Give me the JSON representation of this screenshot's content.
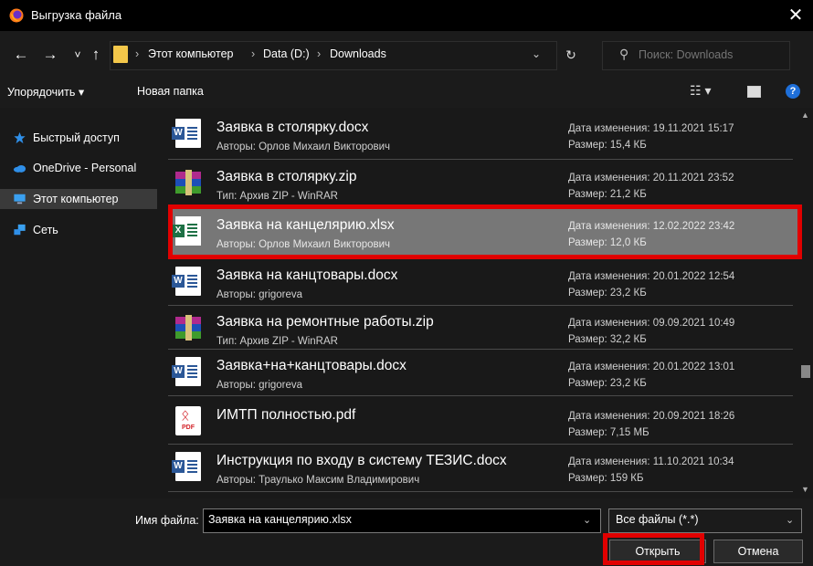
{
  "window": {
    "title": "Выгрузка файла",
    "close_glyph": "✕"
  },
  "nav": {
    "back_glyph": "←",
    "forward_glyph": "→",
    "recent_glyph": "˅",
    "up_glyph": "↑",
    "breadcrumb": [
      "Этот компьютер",
      "Data (D:)",
      "Downloads"
    ],
    "separator": "›",
    "dropdown_glyph": "⌄",
    "refresh_glyph": "↻",
    "search_placeholder": "Поиск: Downloads",
    "search_glyph": "⚲"
  },
  "toolbar": {
    "sort_label": "Упорядочить ▾",
    "new_folder_label": "Новая папка",
    "view_glyph": "☷ ▾",
    "help_glyph": "?"
  },
  "sidebar": {
    "items": [
      {
        "label": "Быстрый доступ",
        "icon": "star-icon",
        "color": "#2f8fe8"
      },
      {
        "label": "OneDrive - Personal",
        "icon": "cloud-icon",
        "color": "#2f8fe8"
      },
      {
        "label": "Этот компьютер",
        "icon": "computer-icon",
        "color": "#3aa0f0",
        "selected": true
      },
      {
        "label": "Сеть",
        "icon": "network-icon",
        "color": "#3aa0f0"
      }
    ]
  },
  "files": [
    {
      "name": "Заявка в столярку.docx",
      "sub": "Авторы: Орлов Михаил Викторович",
      "date": "Дата изменения: 19.11.2021 15:17",
      "size": "Размер: 15,4 КБ",
      "type": "word"
    },
    {
      "name": "Заявка в столярку.zip",
      "sub": "Тип: Архив ZIP - WinRAR",
      "date": "Дата изменения: 20.11.2021 23:52",
      "size": "Размер: 21,2 КБ",
      "type": "rar"
    },
    {
      "name": "Заявка на канцелярию.xlsx",
      "sub": "Авторы: Орлов Михаил Викторович",
      "date": "Дата изменения: 12.02.2022 23:42",
      "size": "Размер: 12,0 КБ",
      "type": "excel",
      "selected": true
    },
    {
      "name": "Заявка на канцтовары.docx",
      "sub": "Авторы: grigoreva",
      "date": "Дата изменения: 20.01.2022 12:54",
      "size": "Размер: 23,2 КБ",
      "type": "word"
    },
    {
      "name": "Заявка на ремонтные работы.zip",
      "sub": "Тип: Архив ZIP - WinRAR",
      "date": "Дата изменения: 09.09.2021 10:49",
      "size": "Размер: 32,2 КБ",
      "type": "rar"
    },
    {
      "name": "Заявка+на+канцтовары.docx",
      "sub": "Авторы: grigoreva",
      "date": "Дата изменения: 20.01.2022 13:01",
      "size": "Размер: 23,2 КБ",
      "type": "word"
    },
    {
      "name": "ИМТП полностью.pdf",
      "sub": "",
      "date": "Дата изменения: 20.09.2021 18:26",
      "size": "Размер: 7,15 МБ",
      "type": "pdf"
    },
    {
      "name": "Инструкция по входу в систему ТЕЗИС.docx",
      "sub": "Авторы: Траулько Максим Владимирович",
      "date": "Дата изменения: 11.10.2021 10:34",
      "size": "Размер: 159 КБ",
      "type": "word"
    }
  ],
  "bottom": {
    "filename_label": "Имя файла:",
    "filename_value": "Заявка на канцелярию.xlsx",
    "filter_value": "Все файлы (*.*)",
    "open_label": "Открыть",
    "cancel_label": "Отмена"
  },
  "colors": {
    "highlight": "#e10000",
    "selection": "#777777",
    "background": "#191919"
  }
}
